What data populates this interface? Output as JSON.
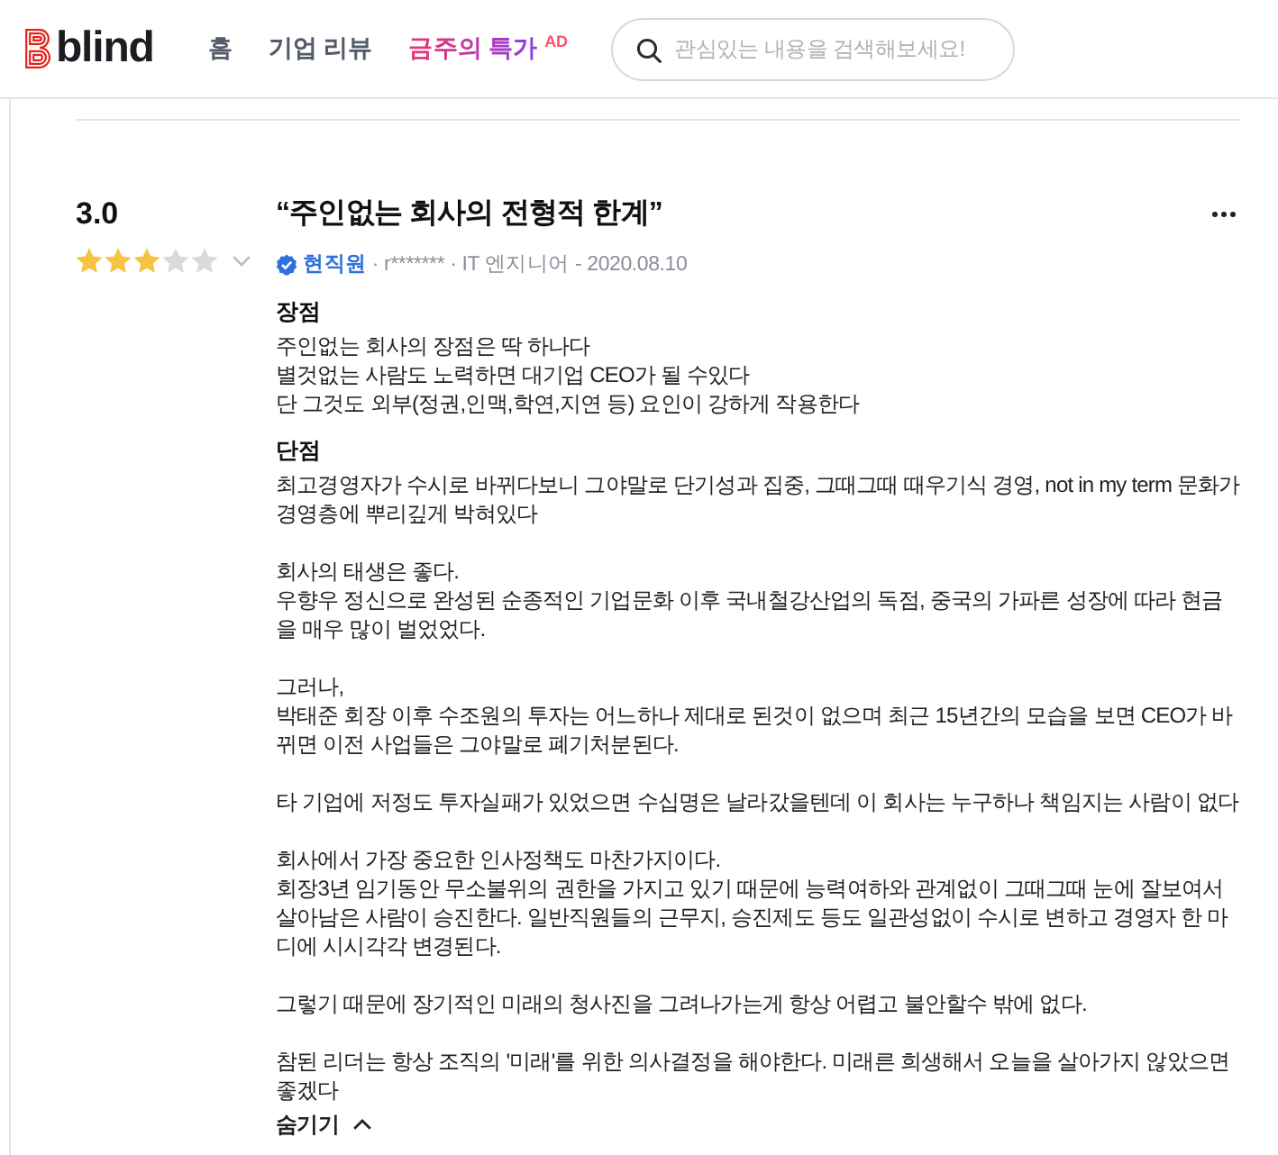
{
  "header": {
    "logo_text": "blind",
    "nav": [
      {
        "label": "홈",
        "kind": "link",
        "selected": false
      },
      {
        "label": "기업 리뷰",
        "kind": "link",
        "selected": false
      },
      {
        "label": "금주의 특가",
        "kind": "promo",
        "selected": false,
        "badge": "AD"
      }
    ],
    "search": {
      "placeholder": "관심있는 내용을 검색해보세요!"
    }
  },
  "review": {
    "rating": "3.0",
    "stars": 3,
    "title": "“주인없는 회사의 전형적 한계”",
    "author": {
      "verified": true,
      "status": "현직원",
      "info": "· r******* · IT 엔지니어 - 2020.08.10"
    },
    "sections": [
      {
        "heading": "장점",
        "paragraphs": [
          "주인없는 회사의 장점은 딱 하나다\n별것없는 사람도 노력하면 대기업 CEO가 될 수있다\n단 그것도 외부(정권,인맥,학연,지연 등) 요인이 강하게 작용한다"
        ]
      },
      {
        "heading": "단점",
        "paragraphs": [
          "최고경영자가 수시로 바뀌다보니 그야말로 단기성과 집중, 그때그때 때우기식 경영, not in my term 문화가 경영층에 뿌리깊게 박혀있다",
          "회사의 태생은 좋다.\n우향우 정신으로 완성된 순종적인 기업문화 이후 국내철강산업의 독점, 중국의 가파른 성장에 따라 현금을 매우 많이 벌었었다.",
          "그러나,\n박태준 회장 이후 수조원의 투자는 어느하나 제대로 된것이 없으며 최근 15년간의 모습을 보면 CEO가 바뀌면 이전 사업들은 그야말로 폐기처분된다.",
          "타 기업에 저정도 투자실패가 있었으면 수십명은 날라갔을텐데 이 회사는 누구하나 책임지는 사람이 없다",
          "회사에서 가장 중요한 인사정책도 마찬가지이다.\n회장3년 임기동안 무소불위의 권한을 가지고 있기 때문에 능력여하와 관계없이 그때그때 눈에 잘보여서 살아남은 사람이 승진한다. 일반직원들의 근무지, 승진제도 등도 일관성없이 수시로 변하고 경영자 한 마디에 시시각각 변경된다.",
          "그렇기 때문에 장기적인 미래의 청사진을 그려나가는게 항상 어렵고 불안할수 밖에 없다.",
          "참된 리더는 항상 조직의 '미래'를 위한 의사결정을 해야한다. 미래른 희생해서 오늘을 살아가지 않았으면 좋겠다"
        ]
      }
    ],
    "collapse_label": "숨기기"
  }
}
